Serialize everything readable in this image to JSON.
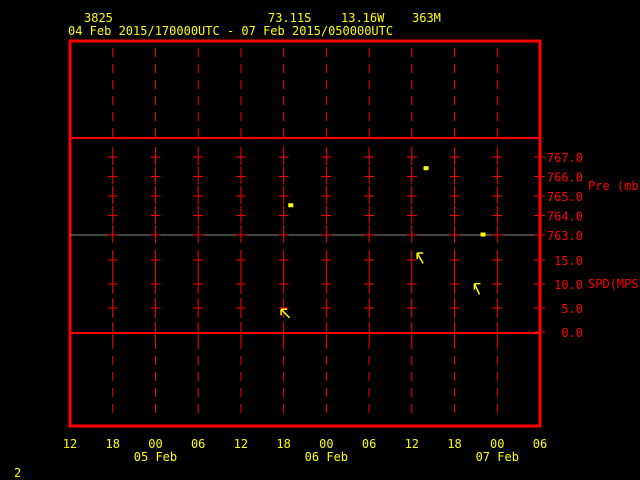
{
  "header": {
    "station_id": "3825",
    "latitude": "73.11S",
    "longitude": "13.16W",
    "elevation": "363M",
    "period": "04 Feb 2015/170000UTC - 07 Feb 2015/050000UTC"
  },
  "footer": {
    "page_number": "2"
  },
  "colors": {
    "frame": "#ff0000",
    "text": "#ffff00",
    "data": "#ffff00",
    "background": "#000000"
  },
  "chart_data": {
    "type": "scatter",
    "title": "04 Feb 2015/170000UTC - 07 Feb 2015/050000UTC",
    "x_start": "04 Feb 2015 12UTC",
    "x_range_hours": [
      0,
      66
    ],
    "x_tick_labels": [
      "12",
      "18",
      "00",
      "06",
      "12",
      "18",
      "00",
      "06",
      "12",
      "18",
      "00",
      "06"
    ],
    "x_date_labels": [
      {
        "label": "05 Feb",
        "hour": 12
      },
      {
        "label": "06 Feb",
        "hour": 36
      },
      {
        "label": "07 Feb",
        "hour": 60
      }
    ],
    "panels": [
      {
        "name": "pressure",
        "ylabel": "Pre (mb)",
        "ylim": [
          763.0,
          767.0
        ],
        "y_tick_labels": [
          "767.0",
          "766.0",
          "765.0",
          "764.0",
          "763.0"
        ],
        "y_ticks": [
          767,
          766,
          765,
          764,
          763
        ],
        "points": [
          {
            "hour": 31,
            "value": 764.5
          },
          {
            "hour": 50,
            "value": 766.4
          },
          {
            "hour": 58,
            "value": 763.0
          }
        ]
      },
      {
        "name": "wind_speed",
        "ylabel": "SPD(MPS)",
        "ylim": [
          0.0,
          15.0
        ],
        "y_tick_labels": [
          "15.0",
          "10.0",
          "5.0",
          "0.0"
        ],
        "y_ticks": [
          15,
          10,
          5,
          0
        ],
        "points": [
          {
            "hour": 30,
            "value": 4.2,
            "direction_deg": 135
          },
          {
            "hour": 49,
            "value": 15.8,
            "direction_deg": 150
          },
          {
            "hour": 57,
            "value": 9.4,
            "direction_deg": 155
          }
        ]
      }
    ]
  }
}
